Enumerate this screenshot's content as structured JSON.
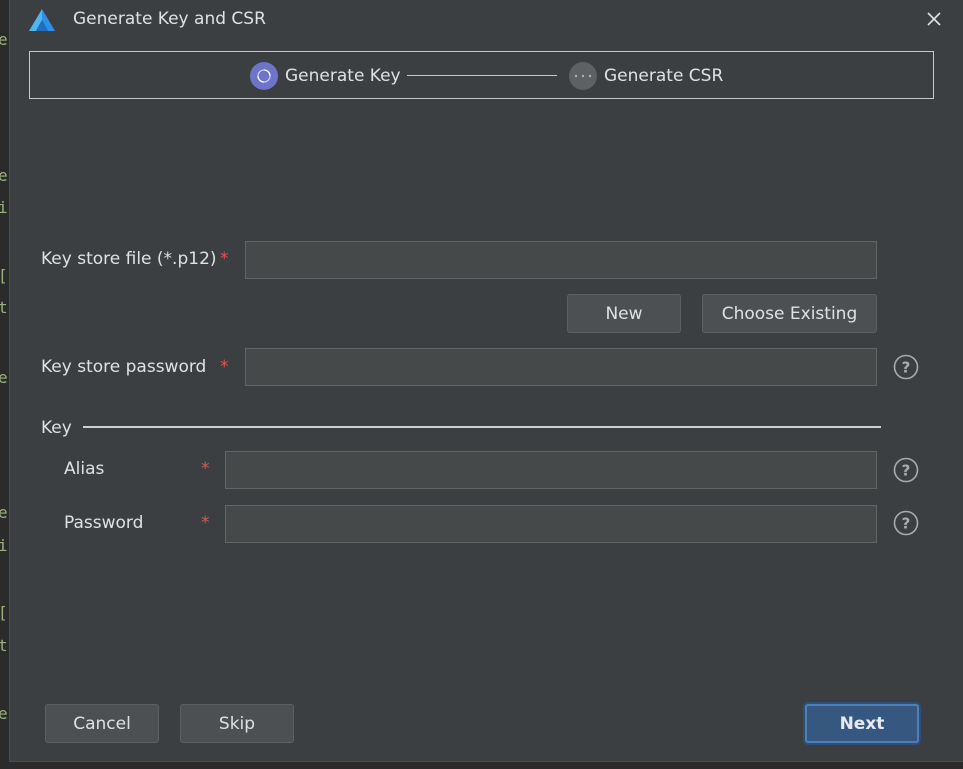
{
  "background_editor": {
    "glyphs": [
      "e",
      "e",
      "i",
      "[",
      "t",
      "e",
      "e",
      "i",
      "[",
      "t",
      "e"
    ]
  },
  "dialog": {
    "title": "Generate Key and CSR",
    "logo_icon": "app-logo-icon",
    "close_icon": "close-icon"
  },
  "steps": [
    {
      "label": "Generate Key",
      "state": "current",
      "color": "#6e74c9"
    },
    {
      "label": "Generate CSR",
      "state": "pending",
      "color": "#5e6164"
    }
  ],
  "form": {
    "keystore_file": {
      "label": "Key store file (*.p12)",
      "required_mark": "*",
      "value": "",
      "placeholder": ""
    },
    "new_button": "New",
    "choose_existing_button": "Choose Existing",
    "keystore_password": {
      "label": "Key store password",
      "required_mark": "*",
      "value": ""
    },
    "key_section_label": "Key",
    "alias": {
      "label": "Alias",
      "required_mark": "*",
      "value": ""
    },
    "password": {
      "label": "Password",
      "required_mark": "*",
      "value": ""
    }
  },
  "footer": {
    "cancel": "Cancel",
    "skip": "Skip",
    "next": "Next"
  },
  "colors": {
    "dialog_bg": "#3c3f41",
    "input_bg": "#45494a",
    "required": "#e05555",
    "primary": "#365880",
    "text": "#dfe1e5"
  }
}
